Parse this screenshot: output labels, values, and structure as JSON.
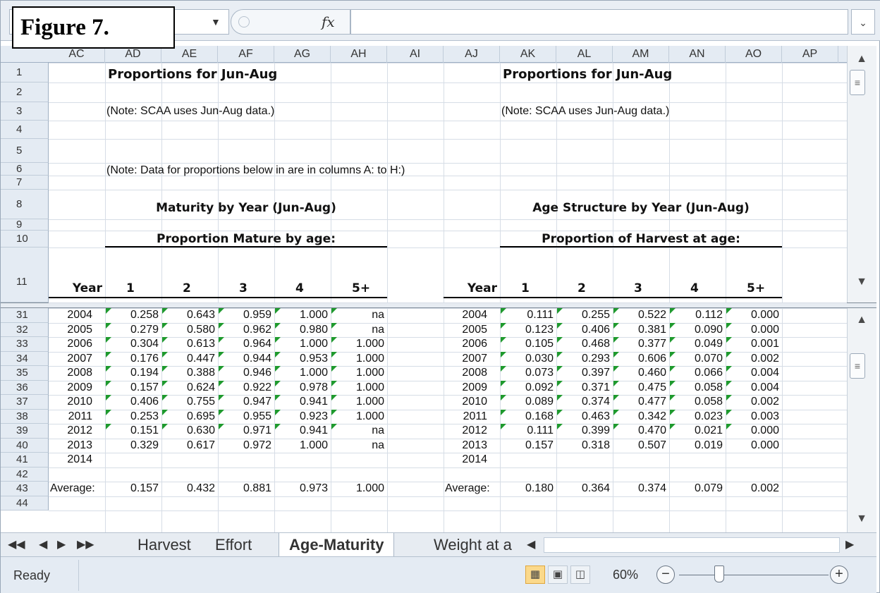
{
  "figure_label": "Figure 7.",
  "formula_bar": {
    "fx_label": "fx",
    "expand_icon": "chevron-down-icon"
  },
  "columns": [
    "AC",
    "AD",
    "AE",
    "AF",
    "AG",
    "AH",
    "AI",
    "AJ",
    "AK",
    "AL",
    "AM",
    "AN",
    "AO",
    "AP"
  ],
  "top_rows": [
    "1",
    "2",
    "3",
    "4",
    "5",
    "6",
    "7",
    "8",
    "9",
    "10",
    "11"
  ],
  "bottom_rows": [
    "31",
    "32",
    "33",
    "34",
    "35",
    "36",
    "37",
    "38",
    "39",
    "40",
    "41",
    "42",
    "43",
    "44"
  ],
  "sheet": {
    "title_left": "Proportions for Jun-Aug",
    "title_right": "Proportions for Jun-Aug",
    "note_left": "(Note:  SCAA uses Jun-Aug data.)",
    "note_right": "(Note:  SCAA uses Jun-Aug data.)",
    "note_data": "(Note:  Data for proportions below in are in columns A: to H:)",
    "heading_left": "Maturity by Year (Jun-Aug)",
    "heading_right": "Age Structure by Year (Jun-Aug)",
    "sub_left": "Proportion Mature by age:",
    "sub_right": "Proportion of Harvest at age:",
    "year_header": "Year",
    "age_headers": [
      "1",
      "2",
      "3",
      "4",
      "5+"
    ],
    "maturity": [
      {
        "year": "2004",
        "v": [
          "0.258",
          "0.643",
          "0.959",
          "1.000",
          "na"
        ]
      },
      {
        "year": "2005",
        "v": [
          "0.279",
          "0.580",
          "0.962",
          "0.980",
          "na"
        ]
      },
      {
        "year": "2006",
        "v": [
          "0.304",
          "0.613",
          "0.964",
          "1.000",
          "1.000"
        ]
      },
      {
        "year": "2007",
        "v": [
          "0.176",
          "0.447",
          "0.944",
          "0.953",
          "1.000"
        ]
      },
      {
        "year": "2008",
        "v": [
          "0.194",
          "0.388",
          "0.946",
          "1.000",
          "1.000"
        ]
      },
      {
        "year": "2009",
        "v": [
          "0.157",
          "0.624",
          "0.922",
          "0.978",
          "1.000"
        ]
      },
      {
        "year": "2010",
        "v": [
          "0.406",
          "0.755",
          "0.947",
          "0.941",
          "1.000"
        ]
      },
      {
        "year": "2011",
        "v": [
          "0.253",
          "0.695",
          "0.955",
          "0.923",
          "1.000"
        ]
      },
      {
        "year": "2012",
        "v": [
          "0.151",
          "0.630",
          "0.971",
          "0.941",
          "na"
        ]
      },
      {
        "year": "2013",
        "v": [
          "0.329",
          "0.617",
          "0.972",
          "1.000",
          "na"
        ]
      },
      {
        "year": "2014",
        "v": [
          "",
          "",
          "",
          "",
          ""
        ]
      }
    ],
    "harvest": [
      {
        "year": "2004",
        "v": [
          "0.111",
          "0.255",
          "0.522",
          "0.112",
          "0.000"
        ]
      },
      {
        "year": "2005",
        "v": [
          "0.123",
          "0.406",
          "0.381",
          "0.090",
          "0.000"
        ]
      },
      {
        "year": "2006",
        "v": [
          "0.105",
          "0.468",
          "0.377",
          "0.049",
          "0.001"
        ]
      },
      {
        "year": "2007",
        "v": [
          "0.030",
          "0.293",
          "0.606",
          "0.070",
          "0.002"
        ]
      },
      {
        "year": "2008",
        "v": [
          "0.073",
          "0.397",
          "0.460",
          "0.066",
          "0.004"
        ]
      },
      {
        "year": "2009",
        "v": [
          "0.092",
          "0.371",
          "0.475",
          "0.058",
          "0.004"
        ]
      },
      {
        "year": "2010",
        "v": [
          "0.089",
          "0.374",
          "0.477",
          "0.058",
          "0.002"
        ]
      },
      {
        "year": "2011",
        "v": [
          "0.168",
          "0.463",
          "0.342",
          "0.023",
          "0.003"
        ]
      },
      {
        "year": "2012",
        "v": [
          "0.111",
          "0.399",
          "0.470",
          "0.021",
          "0.000"
        ]
      },
      {
        "year": "2013",
        "v": [
          "0.157",
          "0.318",
          "0.507",
          "0.019",
          "0.000"
        ]
      },
      {
        "year": "2014",
        "v": [
          "",
          "",
          "",
          "",
          ""
        ]
      }
    ],
    "average_label": "Average:",
    "maturity_avg": [
      "0.157",
      "0.432",
      "0.881",
      "0.973",
      "1.000"
    ],
    "harvest_avg": [
      "0.180",
      "0.364",
      "0.374",
      "0.079",
      "0.002"
    ]
  },
  "tabs": [
    "Harvest",
    "Effort",
    "Age-Maturity",
    "Weight at a"
  ],
  "active_tab": "Age-Maturity",
  "status": {
    "ready": "Ready",
    "zoom": "60%"
  }
}
